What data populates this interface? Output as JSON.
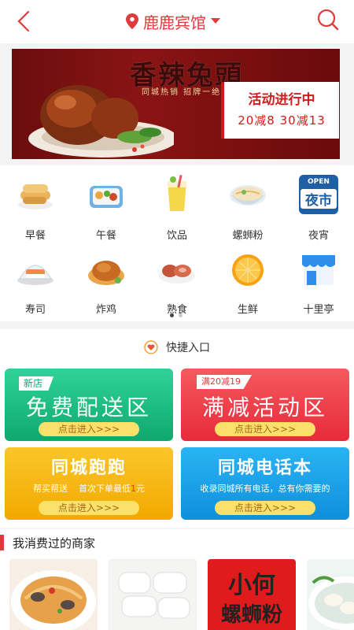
{
  "header": {
    "location": "鹿鹿宾馆"
  },
  "banner": {
    "title": "香辣兔頭",
    "subtitle": "同城热销 招牌一绝",
    "promo_title": "活动进行中",
    "promo_deals": "20减8  30减13"
  },
  "categories": [
    {
      "label": "早餐",
      "icon": "breakfast-icon"
    },
    {
      "label": "午餐",
      "icon": "lunch-icon"
    },
    {
      "label": "饮品",
      "icon": "drink-icon"
    },
    {
      "label": "螺蛳粉",
      "icon": "noodle-icon"
    },
    {
      "label": "夜宵",
      "icon": "night-market-icon"
    },
    {
      "label": "寿司",
      "icon": "sushi-icon"
    },
    {
      "label": "炸鸡",
      "icon": "fried-chicken-icon"
    },
    {
      "label": "熟食",
      "icon": "deli-icon"
    },
    {
      "label": "生鲜",
      "icon": "fresh-icon"
    },
    {
      "label": "十里亭",
      "icon": "shop-icon"
    }
  ],
  "night_badge": {
    "top": "OPEN",
    "bottom": "夜市"
  },
  "quick": {
    "title": "快捷入口",
    "cards": [
      {
        "tag": "新店",
        "title": "免费配送区",
        "enter": "点击进入>>>"
      },
      {
        "tag": "满20减19",
        "title": "满减活动区",
        "enter": "点击进入>>>"
      },
      {
        "title": "同城跑跑",
        "desc_left": "帮买帮送",
        "desc_right": "首次下单最低",
        "desc_price": "1",
        "desc_unit": "元",
        "enter": "点击进入>>>"
      },
      {
        "title": "同城电话本",
        "desc": "收录同城所有电话，总有你需要的",
        "enter": "点击进入>>>"
      }
    ]
  },
  "merchants": {
    "title": "我消费过的商家",
    "third_sign_line1": "小何",
    "third_sign_line2": "螺蛳粉"
  },
  "colors": {
    "accent": "#e0393e",
    "green_card": "#13b985",
    "red_card": "#ef3b48",
    "yellow_card": "#f5b400",
    "blue_card": "#169ee8"
  }
}
